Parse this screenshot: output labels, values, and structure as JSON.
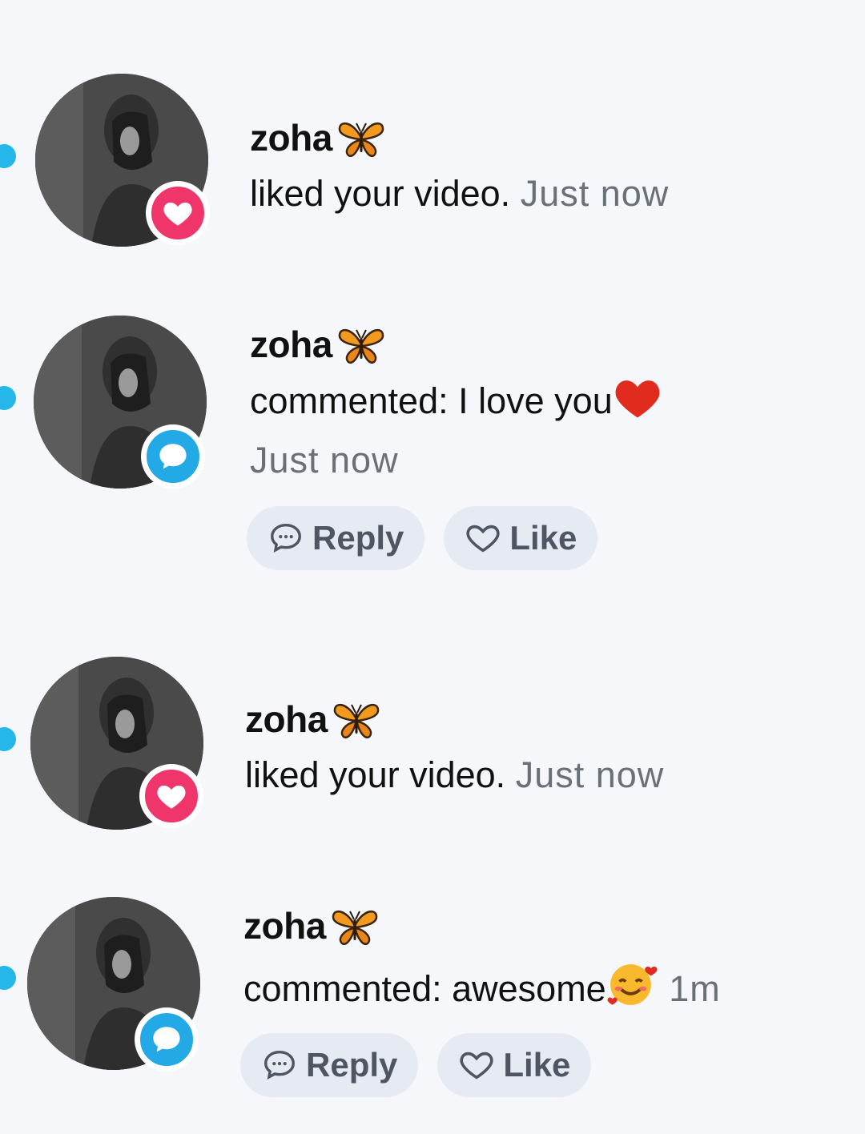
{
  "colors": {
    "like_badge": "#f0356a",
    "comment_badge": "#22a9e6",
    "unread_dot": "#25b6ea",
    "time_text": "#6b6f78"
  },
  "notifications": [
    {
      "type": "like",
      "username": "zoha",
      "username_emoji": "butterfly",
      "action": "liked your video.",
      "time": "Just now",
      "badge_icon": "heart-icon"
    },
    {
      "type": "comment",
      "username": "zoha",
      "username_emoji": "butterfly",
      "action": "commented: I love you",
      "action_emoji": "red-heart",
      "time": "Just now",
      "badge_icon": "comment-bubble-icon",
      "reply_label": "Reply",
      "like_label": "Like"
    },
    {
      "type": "like",
      "username": "zoha",
      "username_emoji": "butterfly",
      "action": "liked your video.",
      "time": "Just now",
      "badge_icon": "heart-icon"
    },
    {
      "type": "comment",
      "username": "zoha",
      "username_emoji": "butterfly",
      "action": "commented: awesome",
      "action_emoji": "smiling-face-with-hearts",
      "time": "1m",
      "badge_icon": "comment-bubble-icon",
      "reply_label": "Reply",
      "like_label": "Like"
    }
  ]
}
